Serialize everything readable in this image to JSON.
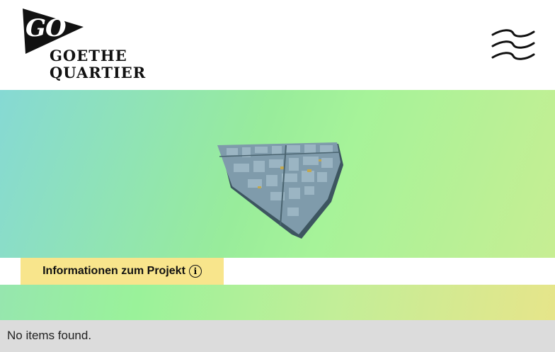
{
  "brand": {
    "logo_mark": "GO",
    "logo_line1": "GOETHE",
    "logo_line2": "QUARTIER"
  },
  "header": {
    "menu_icon": "wavy-hamburger-menu-icon"
  },
  "hero": {
    "image": "3d-quarter-map-model"
  },
  "info_button": {
    "label": "Informationen zum Projekt",
    "icon": "info-icon",
    "icon_glyph": "i"
  },
  "list": {
    "empty_message": "No items found."
  },
  "colors": {
    "accent_yellow": "#f8e58c",
    "gradient_teal": "#86d9d4",
    "gradient_green": "#9af29a",
    "gradient_yellow": "#e6e58a",
    "empty_bg": "#dcdcdc"
  }
}
